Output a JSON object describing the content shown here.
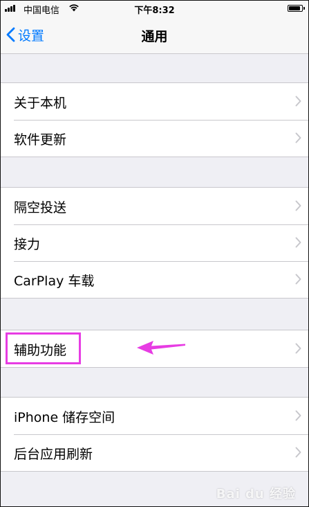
{
  "status_bar": {
    "carrier": "中国电信",
    "time": "下午8:32",
    "battery_level": 0.9
  },
  "nav": {
    "back_label": "设置",
    "title": "通用"
  },
  "groups": [
    {
      "items": [
        {
          "label": "关于本机"
        },
        {
          "label": "软件更新"
        }
      ]
    },
    {
      "items": [
        {
          "label": "隔空投送"
        },
        {
          "label": "接力"
        },
        {
          "label": "CarPlay 车载"
        }
      ]
    },
    {
      "items": [
        {
          "label": "辅助功能"
        }
      ]
    },
    {
      "items": [
        {
          "label": "iPhone 储存空间"
        },
        {
          "label": "后台应用刷新"
        }
      ]
    }
  ],
  "annotation": {
    "highlight_color": "#e73ce3"
  },
  "watermark": {
    "text": "Bai du 经验"
  },
  "colors": {
    "accent": "#007aff",
    "background": "#efeff4",
    "separator": "#c8c7cc",
    "chevron": "#c7c7cc"
  }
}
